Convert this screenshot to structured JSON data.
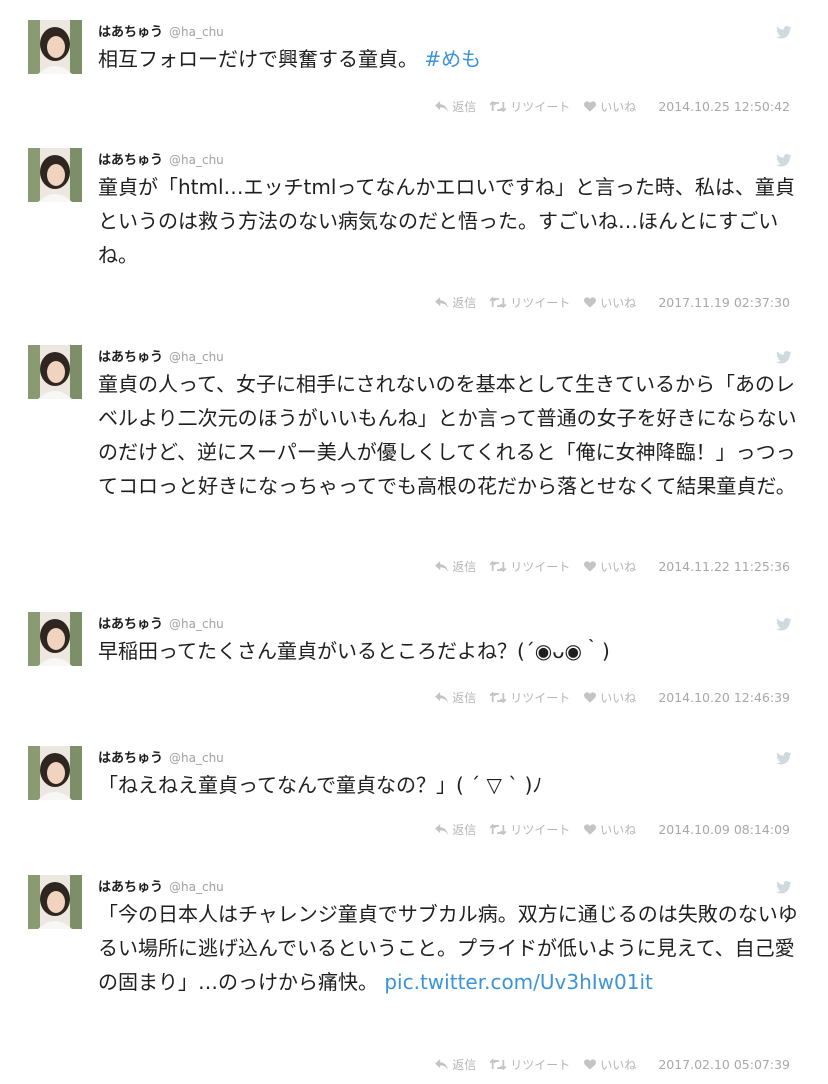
{
  "user": {
    "name": "はあちゅう",
    "handle": "@ha_chu"
  },
  "actions": {
    "reply": "返信",
    "retweet": "リツイート",
    "like": "いいね"
  },
  "icons": {
    "reply": "reply-icon",
    "retweet": "retweet-icon",
    "like": "heart-icon",
    "brand": "twitter-bird-icon"
  },
  "colors": {
    "link": "#3b94d9",
    "muted": "#a8a8a8",
    "text": "#1f1f1f"
  },
  "tweets": [
    {
      "text": "相互フォローだけで興奮する童貞。",
      "hashtag": "#めも",
      "timestamp": "2014.10.25 12:50:42"
    },
    {
      "text": "童貞が「html…エッチtmlってなんかエロいですね」と言った時、私は、童貞というのは救う方法のない病気なのだと悟った。すごいね…ほんとにすごいね。",
      "timestamp": "2017.11.19 02:37:30"
    },
    {
      "text": "童貞の人って、女子に相手にされないのを基本として生きているから「あのレベルより二次元のほうがいいもんね」とか言って普通の女子を好きにならないのだけど、逆にスーパー美人が優しくしてくれると「俺に女神降臨！」っつってコロっと好きになっちゃってでも高根の花だから落とせなくて結果童貞だ。",
      "timestamp": "2014.11.22 11:25:36"
    },
    {
      "text": "早稲田ってたくさん童貞がいるところだよね？(´◉ᴗ◉｀)",
      "timestamp": "2014.10.20 12:46:39"
    },
    {
      "text": "「ねえねえ童貞ってなんで童貞なの？」( ´ ▽ ` )ﾉ",
      "timestamp": "2014.10.09 08:14:09"
    },
    {
      "text": "「今の日本人はチャレンジ童貞でサブカル病。双方に通じるのは失敗のないゆるい場所に逃げ込んでいるということ。プライドが低いように見えて、自己愛の固まり」…のっけから痛快。",
      "link": "pic.twitter.com/Uv3hIw01it",
      "timestamp": "2017.02.10 05:07:39"
    }
  ]
}
